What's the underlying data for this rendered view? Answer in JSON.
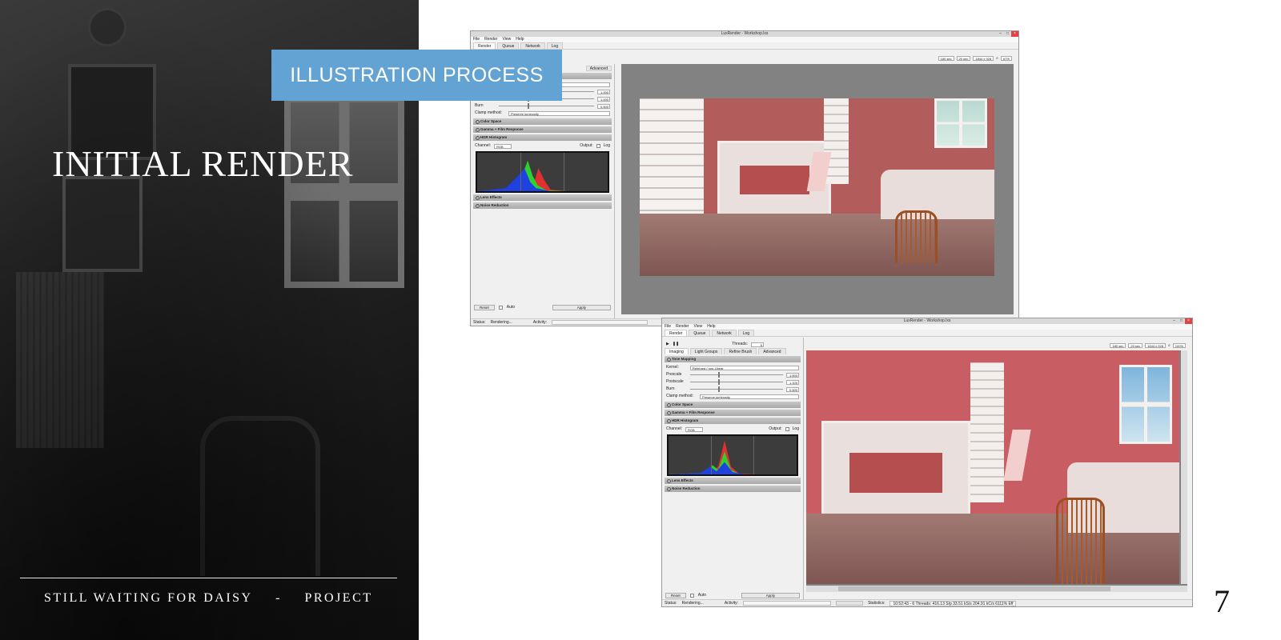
{
  "slide": {
    "title": "INITIAL RENDER",
    "badge": "ILLUSTRATION PROCESS",
    "footer": {
      "left": "STILL WAITING FOR DAISY",
      "separator": "-",
      "right": "PROJECT"
    },
    "page_number": "7",
    "badge_color": "#63a3d3"
  },
  "window1": {
    "title": "LuxRender - Workshop.lxs",
    "menu": [
      "File",
      "Render",
      "View",
      "Help"
    ],
    "tabs": [
      "Render",
      "Queue",
      "Network",
      "Log"
    ],
    "subtab": "Advanced",
    "toolbar": {
      "time": "180 sec",
      "interval": "20 sec",
      "resolution": "1844 x 928",
      "zoom": "67%"
    },
    "fields": [
      {
        "label": "",
        "value": "1.000"
      },
      {
        "label": "Postscale",
        "value": "1.000"
      },
      {
        "label": "Burn",
        "value": "0.500"
      }
    ],
    "clamp_label": "Clamp method:",
    "clamp_value": "Preserve luminosity",
    "sections": [
      "Color Space",
      "Gamma + Film Response",
      "HDR Histogram"
    ],
    "channel_label": "Channel:",
    "channel_value": "RGB",
    "output_label": "Output:",
    "log_label": "Log",
    "sections_after": [
      "Lens Effects",
      "Noise Reduction"
    ],
    "reset": "Reset",
    "auto": "Auto",
    "apply": "Apply",
    "status_label": "Status:",
    "status_value": "Rendering...",
    "activity_label": "Activity:"
  },
  "window2": {
    "title": "LuxRender - Workshop.lxs",
    "menu": [
      "File",
      "Render",
      "View",
      "Help"
    ],
    "tabs": [
      "Render",
      "Queue",
      "Network",
      "Log"
    ],
    "threads_label": "Threads:",
    "threads_value": "6",
    "subtabs": [
      "Imaging",
      "Light Groups",
      "Refine Brush",
      "Advanced"
    ],
    "toolbar": {
      "time": "180 sec",
      "interval": "20 sec",
      "resolution": "1844 x 928",
      "zoom": "100%"
    },
    "tone_mapping": "Tone Mapping",
    "kernel_label": "Kernel:",
    "kernel_value": "Reinhard / non-Linear",
    "fields": [
      {
        "label": "Prescale",
        "value": "1.000"
      },
      {
        "label": "Postscale",
        "value": "1.100"
      },
      {
        "label": "Burn",
        "value": "0.500"
      }
    ],
    "clamp_label": "Clamp method:",
    "clamp_value": "Preserve luminosity",
    "sections": [
      "Color Space",
      "Gamma + Film Response",
      "HDR Histogram"
    ],
    "channel_label": "Channel:",
    "channel_value": "RGB",
    "output_label": "Output:",
    "log_label": "Log",
    "sections_after": [
      "Lens Effects",
      "Noise Reduction"
    ],
    "reset": "Reset",
    "auto": "Auto",
    "apply": "Apply",
    "status_label": "Status:",
    "status_value": "Rendering...",
    "activity_label": "Activity:",
    "statistics_label": "Statistics:",
    "statistics_value": "10:52:43 - 6 Threads: 416.13 S/p 33.51 kS/s 204.91 kC/s 6111% Eff"
  }
}
